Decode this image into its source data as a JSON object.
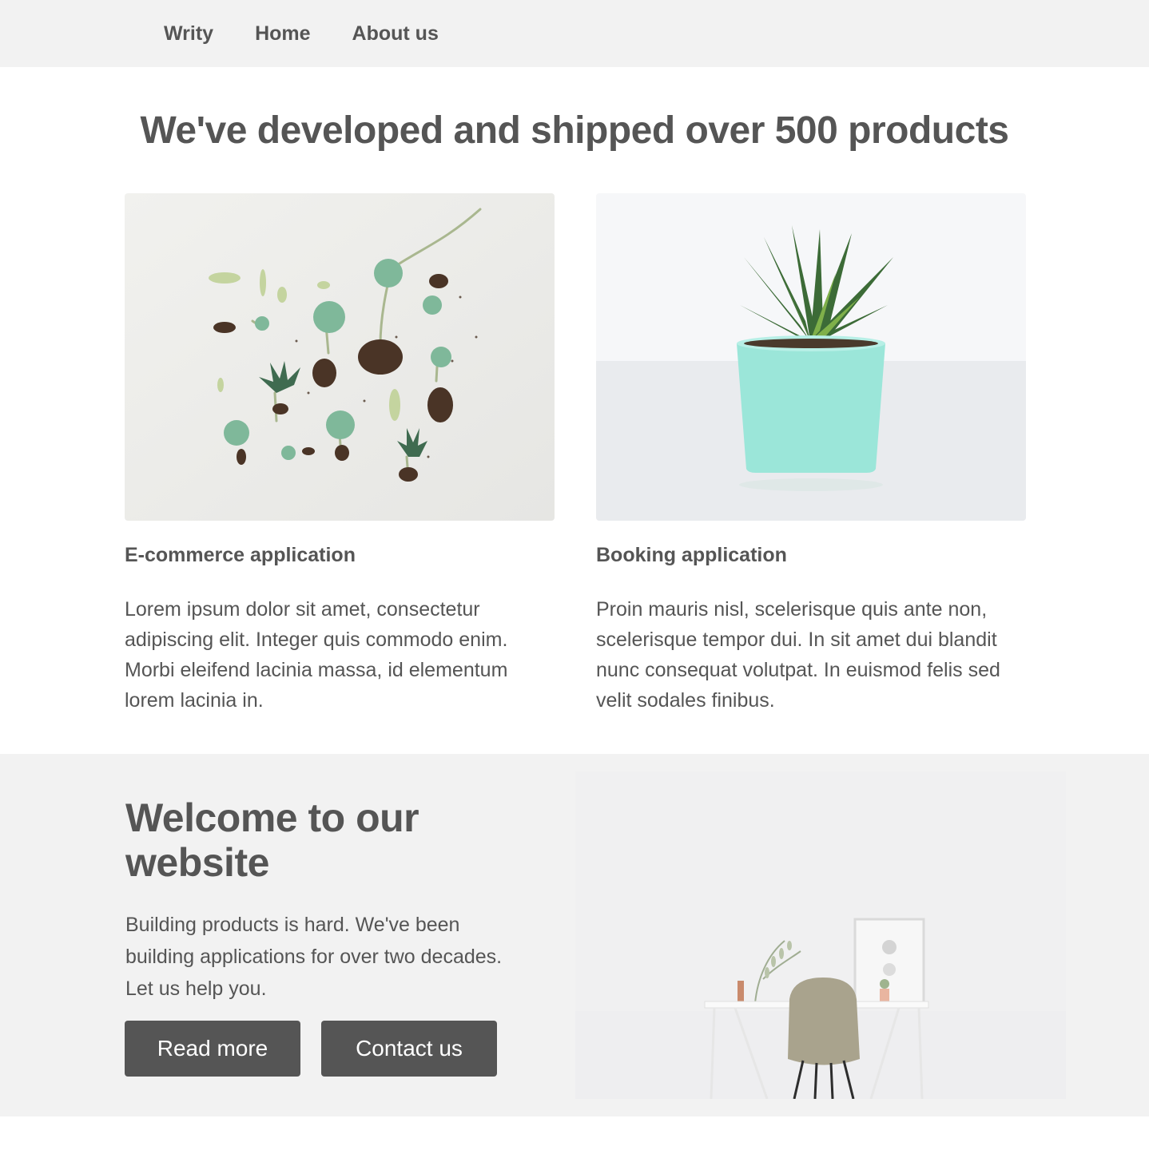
{
  "nav": {
    "brand": "Writy",
    "links": [
      "Home",
      "About us"
    ]
  },
  "products": {
    "title": "We've developed and shipped over 500 products",
    "cards": [
      {
        "title": "E-commerce application",
        "text": "Lorem ipsum dolor sit amet, consectetur adipiscing elit. Integer quis commodo enim. Morbi eleifend lacinia massa, id elementum lorem lacinia in."
      },
      {
        "title": "Booking application",
        "text": "Proin mauris nisl, scelerisque quis ante non, scelerisque tempor dui. In sit amet dui blandit nunc consequat volutpat. In euismod felis sed velit sodales finibus."
      }
    ]
  },
  "hero": {
    "title": "Welcome to our website",
    "text": "Building products is hard. We've been building applications for over two decades. Let us help you.",
    "buttons": [
      "Read more",
      "Contact us"
    ]
  },
  "colors": {
    "text": "#555555",
    "band_background": "#f2f2f2",
    "button_background": "#555555",
    "button_text": "#ffffff"
  }
}
